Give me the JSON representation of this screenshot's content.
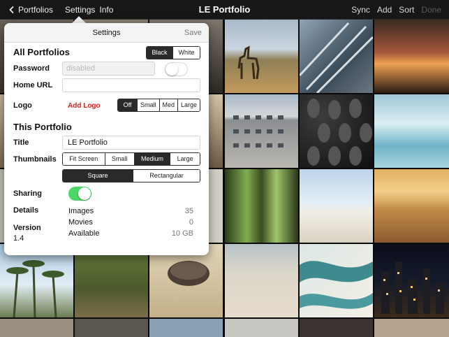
{
  "navbar": {
    "back_label": "Portfolios",
    "settings_label": "Settings",
    "info_label": "Info",
    "title": "LE Portfolio",
    "sync_label": "Sync",
    "add_label": "Add",
    "sort_label": "Sort",
    "done_label": "Done"
  },
  "settings": {
    "title": "Settings",
    "save_label": "Save",
    "all_portfolios": {
      "heading": "All Portfolios",
      "theme_options": [
        "Black",
        "White"
      ],
      "theme_selected": "Black",
      "password_label": "Password",
      "password_placeholder": "disabled",
      "password_enabled": false,
      "home_url_label": "Home URL",
      "home_url_value": "",
      "logo_label": "Logo",
      "add_logo_label": "Add Logo",
      "logo_size_options": [
        "Off",
        "Small",
        "Med",
        "Large"
      ],
      "logo_size_selected": "Off"
    },
    "this_portfolio": {
      "heading": "This Portfolio",
      "title_label": "Title",
      "title_value": "LE Portfolio",
      "thumbnails_label": "Thumbnails",
      "thumbnail_size_options": [
        "Fit Screen",
        "Small",
        "Medium",
        "Large"
      ],
      "thumbnail_size_selected": "Medium",
      "thumbnail_shape_options": [
        "Square",
        "Rectangular"
      ],
      "thumbnail_shape_selected": "Square",
      "sharing_label": "Sharing",
      "sharing_enabled": true,
      "details_label": "Details",
      "details": [
        {
          "label": "Images",
          "value": "35"
        },
        {
          "label": "Movies",
          "value": "0"
        },
        {
          "label": "Available",
          "value": "10 GB"
        }
      ],
      "version_label": "Version",
      "version_value": "1.4"
    }
  },
  "colors": {
    "nav_bg": "#171717",
    "accent_red": "#e02020",
    "toggle_on": "#4bd763",
    "segment_selected": "#2a2a2a"
  },
  "icons": {
    "back": "chevron-left-icon"
  }
}
